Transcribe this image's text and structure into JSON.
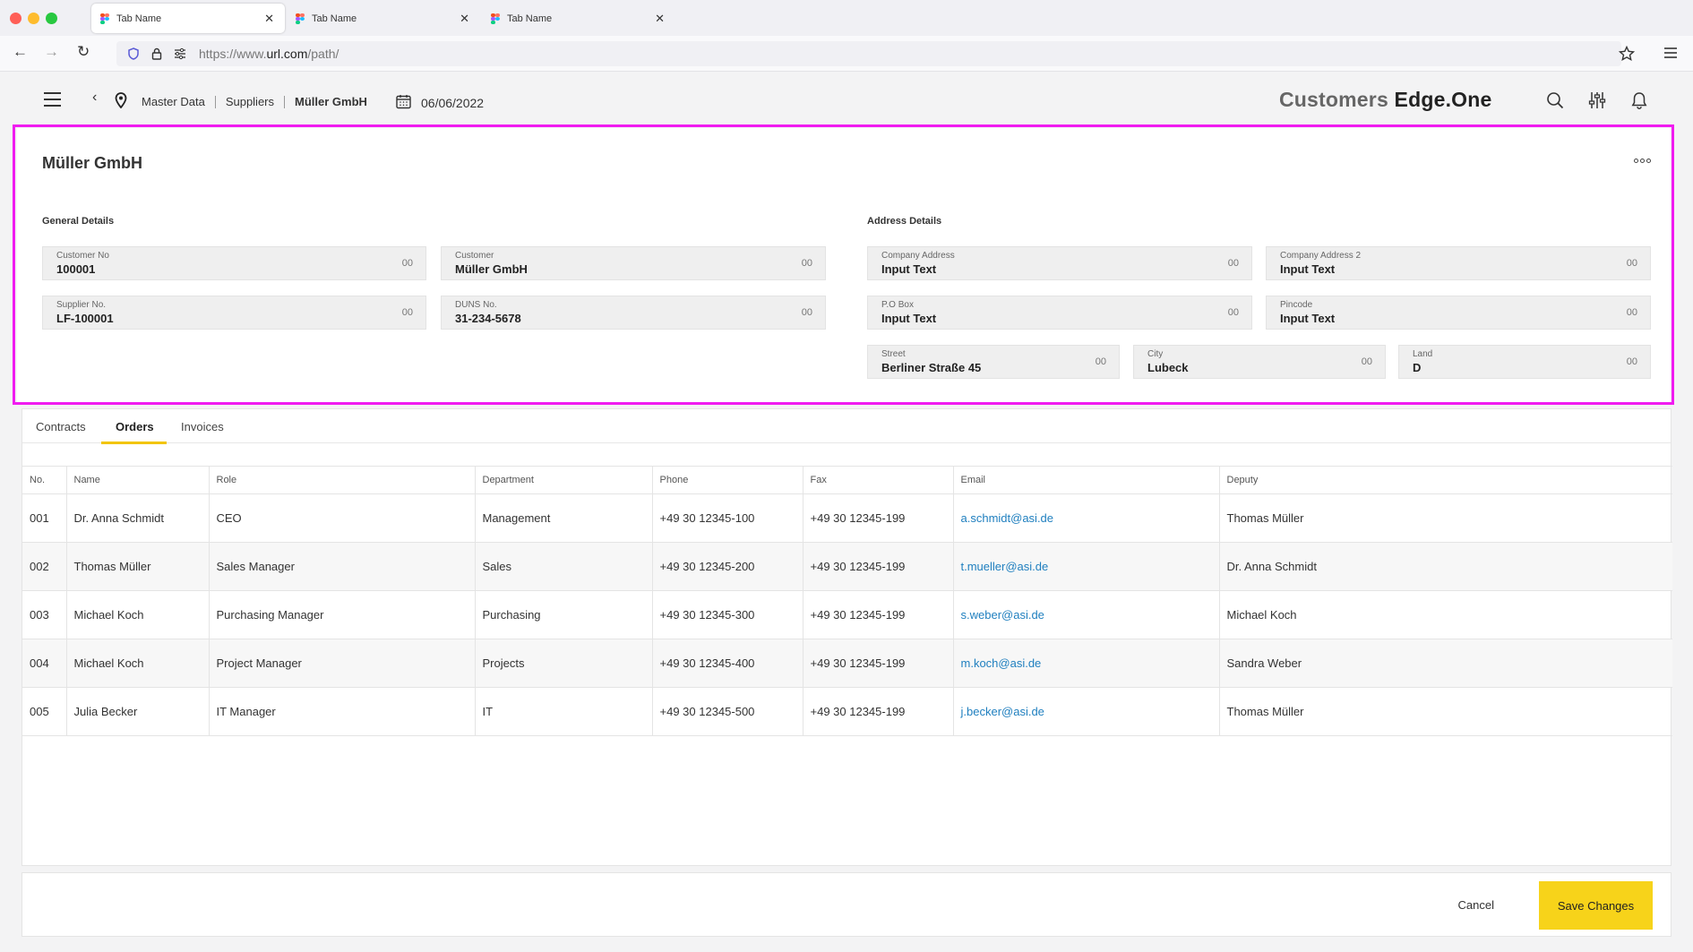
{
  "browser": {
    "tabs": [
      {
        "label": "Tab Name"
      },
      {
        "label": "Tab Name"
      },
      {
        "label": "Tab Name"
      }
    ],
    "url_prefix": "https://www.",
    "url_domain": "url.com",
    "url_path": "/path/"
  },
  "header": {
    "breadcrumbs": [
      "Master Data",
      "Suppliers",
      "Müller GmbH"
    ],
    "date": "06/06/2022",
    "brand_part1": "Customers",
    "brand_part2": "Edge.One"
  },
  "card": {
    "title": "Müller GmbH",
    "general_title": "General Details",
    "address_title": "Address Details",
    "fields": {
      "customer_no": {
        "label": "Customer No",
        "value": "100001",
        "suffix": "00"
      },
      "customer": {
        "label": "Customer",
        "value": "Müller GmbH",
        "suffix": "00"
      },
      "supplier_no": {
        "label": "Supplier No.",
        "value": "LF-100001",
        "suffix": "00"
      },
      "duns_no": {
        "label": "DUNS No.",
        "value": "31-234-5678",
        "suffix": "00"
      },
      "company_address": {
        "label": "Company Address",
        "value": "Input Text",
        "suffix": "00"
      },
      "company_address_2": {
        "label": "Company Address 2",
        "value": "Input Text",
        "suffix": "00"
      },
      "po_box": {
        "label": "P.O Box",
        "value": "Input Text",
        "suffix": "00"
      },
      "pincode": {
        "label": "Pincode",
        "value": "Input Text",
        "suffix": "00"
      },
      "street": {
        "label": "Street",
        "value": "Berliner Straße 45",
        "suffix": "00"
      },
      "city": {
        "label": "City",
        "value": "Lubeck",
        "suffix": "00"
      },
      "land": {
        "label": "Land",
        "value": "D",
        "suffix": "00"
      }
    }
  },
  "tabs": [
    "Contracts",
    "Orders",
    "Invoices"
  ],
  "active_tab": "Orders",
  "table": {
    "columns": [
      "No.",
      "Name",
      "Role",
      "Department",
      "Phone",
      "Fax",
      "Email",
      "Deputy"
    ],
    "rows": [
      [
        "001",
        "Dr. Anna Schmidt",
        "CEO",
        "Management",
        "+49 30 12345-100",
        "+49 30 12345-199",
        "a.schmidt@asi.de",
        "Thomas Müller"
      ],
      [
        "002",
        "Thomas Müller",
        "Sales Manager",
        "Sales",
        "+49 30 12345-200",
        "+49 30 12345-199",
        "t.mueller@asi.de",
        "Dr. Anna Schmidt"
      ],
      [
        "003",
        "Michael Koch",
        "Purchasing Manager",
        "Purchasing",
        "+49 30 12345-300",
        "+49 30 12345-199",
        "s.weber@asi.de",
        "Michael Koch"
      ],
      [
        "004",
        "Michael Koch",
        "Project Manager",
        "Projects",
        "+49 30 12345-400",
        "+49 30 12345-199",
        "m.koch@asi.de",
        "Sandra Weber"
      ],
      [
        "005",
        "Julia Becker",
        "IT Manager",
        "IT",
        "+49 30 12345-500",
        "+49 30 12345-199",
        "j.becker@asi.de",
        "Thomas Müller"
      ]
    ]
  },
  "footer": {
    "cancel_label": "Cancel",
    "save_label": "Save Changes"
  },
  "colors": {
    "accent": "#f7d31a",
    "highlight": "#f01bf0",
    "link": "#1f7fbf"
  }
}
